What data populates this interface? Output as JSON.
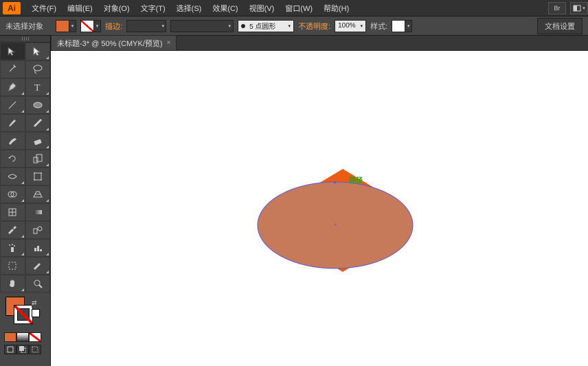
{
  "app": {
    "logo": "Ai"
  },
  "menus": {
    "file": "文件(F)",
    "edit": "编辑(E)",
    "object": "对象(O)",
    "type": "文字(T)",
    "select": "选择(S)",
    "effect": "效果(C)",
    "view": "视图(V)",
    "window": "窗口(W)",
    "help": "帮助(H)",
    "br": "Br"
  },
  "control": {
    "noselection": "未选择对象",
    "stroke": "描边:",
    "brush_preset": "5 点圆形",
    "opacity_label": "不透明度:",
    "opacity_value": "100%",
    "style_label": "样式:",
    "docsetup": "文档设置"
  },
  "tab": {
    "title": "未标题-3* @ 50% (CMYK/预览)"
  },
  "canvas": {
    "path_label": "路径",
    "fill_color": "#e06a33",
    "ellipse_fill": "#c77a5a",
    "ellipse_stroke": "#6a6ae8"
  },
  "icons": {
    "dd": "▾",
    "arrows": "⇄"
  }
}
